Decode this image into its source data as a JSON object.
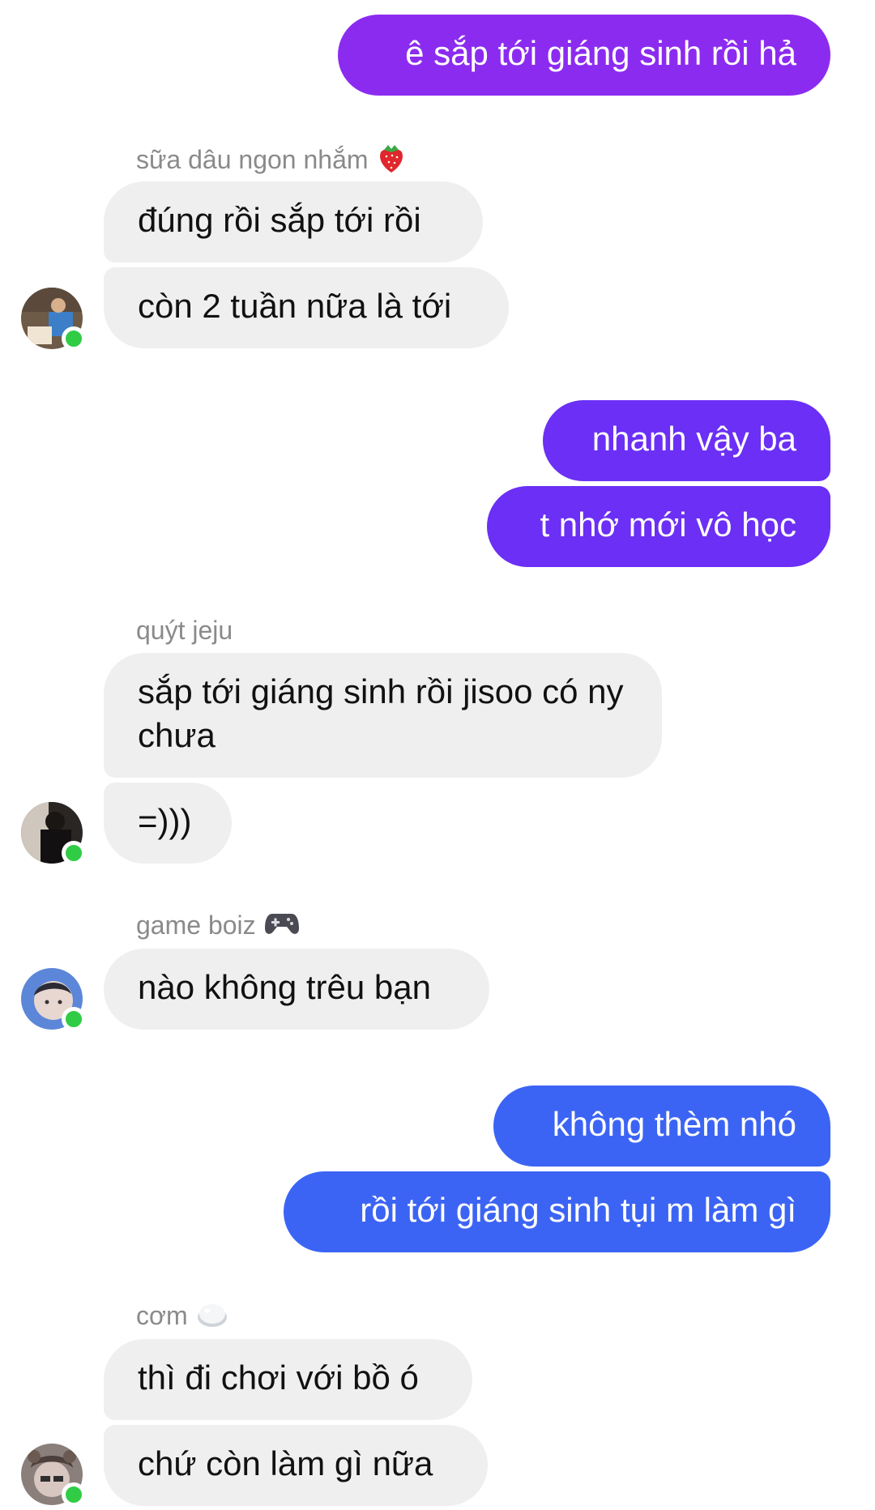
{
  "messages": {
    "m1": "ê sắp tới giáng sinh rồi hả",
    "g1_sender": "sữa dâu ngon nhắm",
    "g1_sender_icon": "strawberry-icon",
    "m2": "đúng rồi sắp tới rồi",
    "m3": "còn 2 tuần nữa là tới",
    "m4": "nhanh vậy ba",
    "m5": "t nhớ mới vô học",
    "g2_sender": "quýt jeju",
    "m6": "sắp tới giáng sinh rồi jisoo có ny chưa",
    "m7": "=)))",
    "g3_sender": "game boiz",
    "g3_sender_icon": "game-controller-icon",
    "m8": "nào không trêu bạn",
    "m9": "không thèm nhó",
    "m10": "rồi tới giáng sinh tụi m làm gì",
    "g4_sender": "cơm",
    "g4_sender_icon": "rice-ball-icon",
    "m11": "thì đi chơi với bồ ó",
    "m12": "chứ còn làm gì nữa"
  },
  "colors": {
    "outgoing_purple": "#8c2bf0",
    "outgoing_indigo": "#6b2ff5",
    "outgoing_blue": "#3c64f4",
    "incoming_gray": "#efefef",
    "presence_green": "#31cc46"
  }
}
